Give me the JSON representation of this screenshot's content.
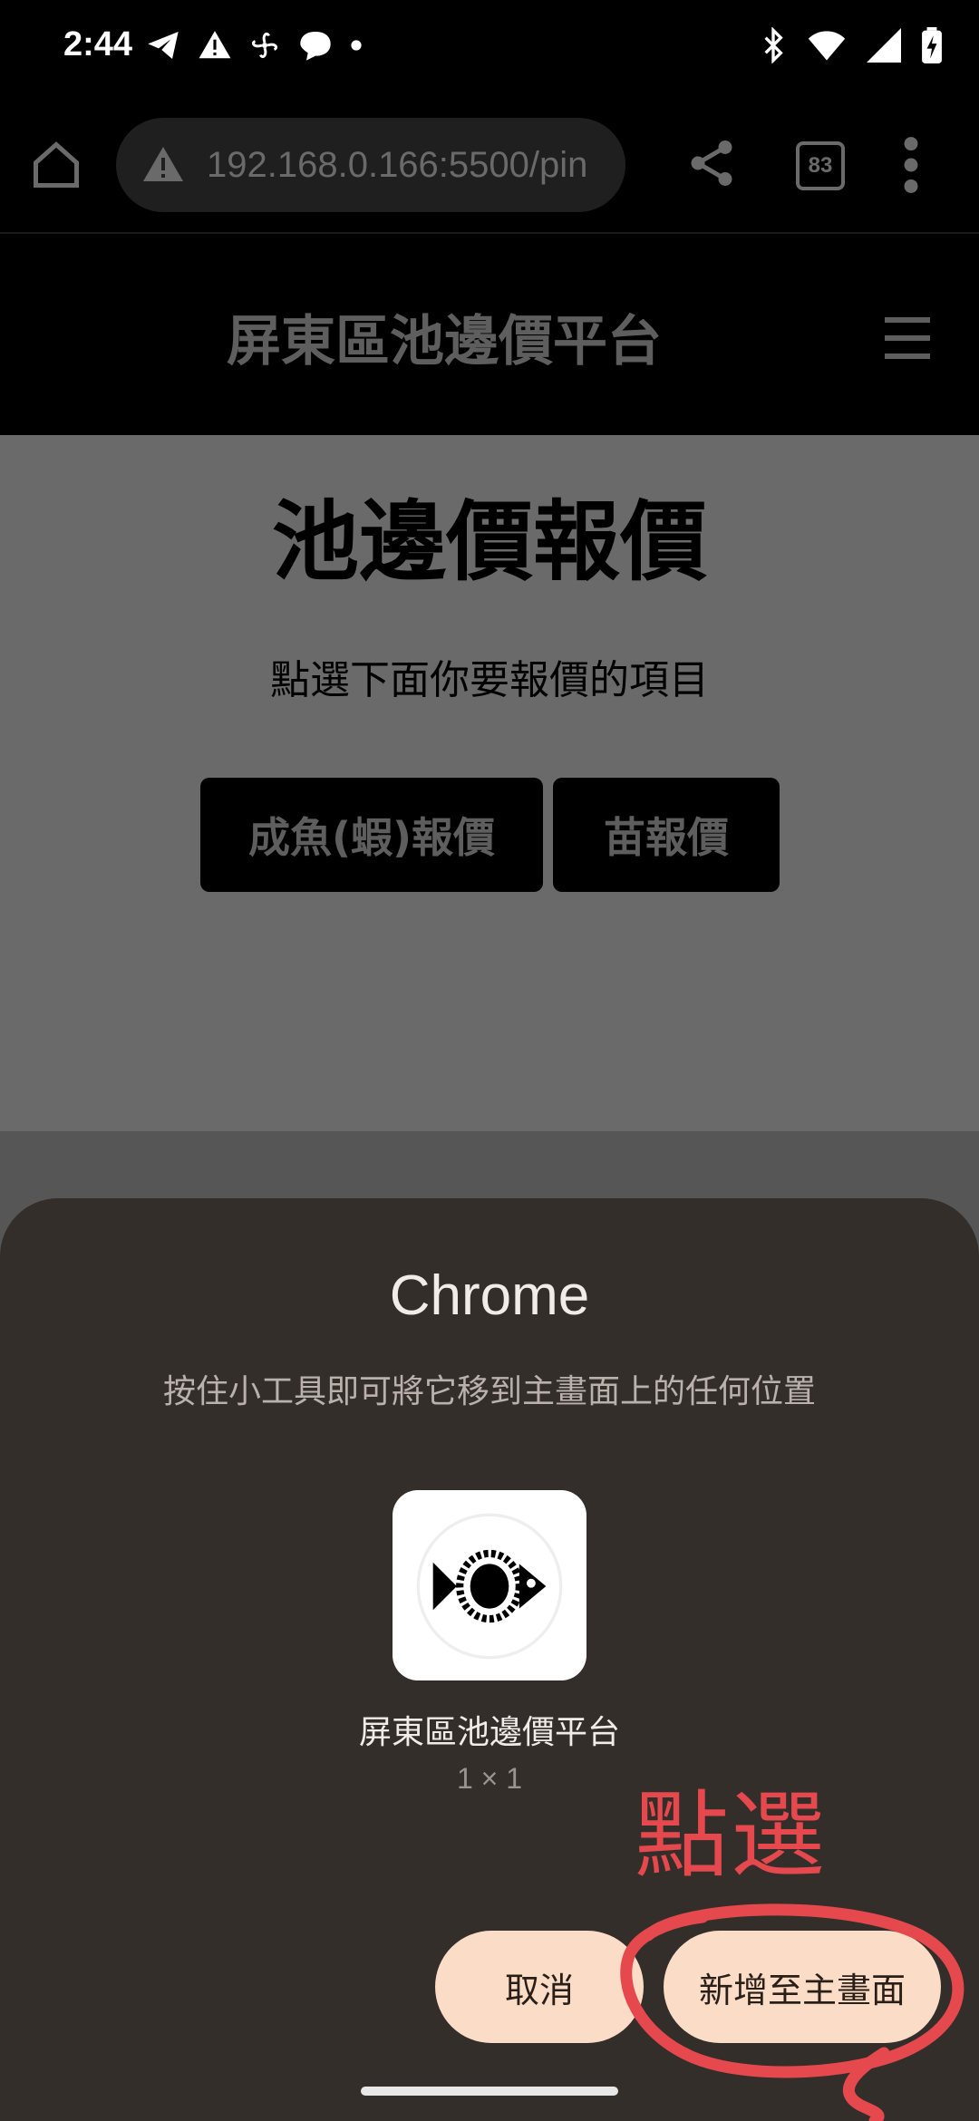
{
  "status_bar": {
    "time": "2:44",
    "left_icons": [
      "telegram-icon",
      "warning-icon",
      "fan-icon",
      "chat-bubble-icon",
      "dot-icon"
    ],
    "right_icons": [
      "bluetooth-icon",
      "wifi-icon",
      "signal-icon",
      "battery-charging-icon"
    ]
  },
  "browser": {
    "url": "192.168.0.166:5500/pin",
    "tab_count": "83"
  },
  "site": {
    "title": "屏東區池邊價平台"
  },
  "page": {
    "heading": "池邊價報價",
    "subtitle": "點選下面你要報價的項目",
    "buttons": {
      "fish": "成魚(蝦)報價",
      "fry": "苗報價"
    }
  },
  "sheet": {
    "title": "Chrome",
    "hint": "按住小工具即可將它移到主畫面上的任何位置",
    "widget_name": "屏東區池邊價平台",
    "widget_size": "1 × 1",
    "cancel_label": "取消",
    "add_label": "新增至主畫面"
  },
  "annotation": {
    "text": "點選",
    "color": "#e5484d"
  },
  "colors": {
    "sheet_bg": "#342e2b",
    "button_bg": "#fbdcc6"
  }
}
